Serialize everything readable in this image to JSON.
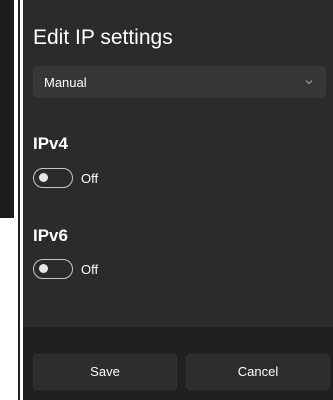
{
  "dialog": {
    "title": "Edit IP settings",
    "mode_dropdown": {
      "selected": "Manual",
      "icon": "chevron-down-icon"
    },
    "ipv4": {
      "label": "IPv4",
      "toggle_state": "Off",
      "enabled": false
    },
    "ipv6": {
      "label": "IPv6",
      "toggle_state": "Off",
      "enabled": false
    },
    "buttons": {
      "save": "Save",
      "cancel": "Cancel"
    }
  },
  "colors": {
    "dialog_bg": "#2b2b2b",
    "footer_bg": "#202020",
    "text": "#ffffff",
    "dropdown_bg": "#373737"
  }
}
